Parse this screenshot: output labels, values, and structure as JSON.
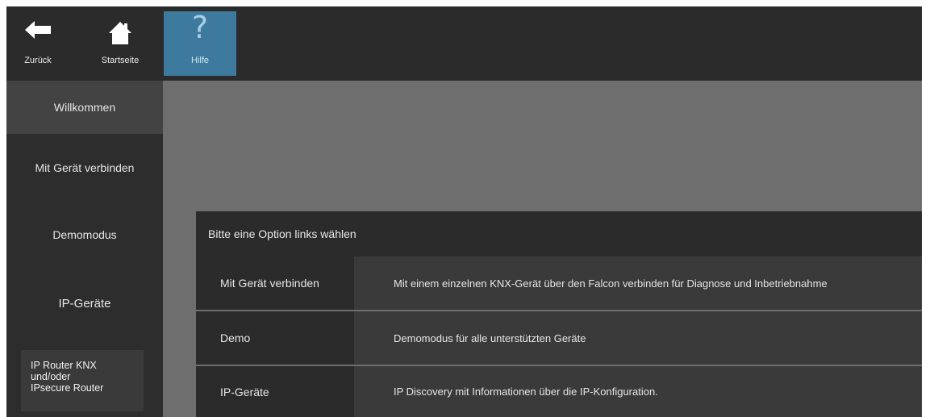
{
  "toolbar": {
    "back_label": "Zurück",
    "home_label": "Startseite",
    "help_symbol": "?",
    "help_label": "Hilfe"
  },
  "sidebar": {
    "items": [
      {
        "label": "Willkommen"
      },
      {
        "label": "Mit Gerät verbinden"
      },
      {
        "label": "Demomodus"
      },
      {
        "label": "IP-Geräte"
      }
    ],
    "router": {
      "line1": "IP Router KNX",
      "line2": "und/oder",
      "line3": "IPsecure Router"
    }
  },
  "panel": {
    "header": "Bitte eine Option links wählen",
    "options": [
      {
        "name": "Mit Gerät verbinden",
        "description": "Mit einem einzelnen KNX-Gerät über den Falcon verbinden für Diagnose und Inbetriebnahme"
      },
      {
        "name": "Demo",
        "description": "Demomodus für alle unterstützten Geräte"
      },
      {
        "name": "IP-Geräte",
        "description": "IP Discovery mit Informationen über die IP-Konfiguration."
      }
    ]
  },
  "colors": {
    "toolbar_bg": "#2b2b2b",
    "help_accent": "#3d7a9e",
    "content_bg": "#6e6e6e",
    "sidebar_active": "#434343"
  },
  "icons": {
    "back": "arrow-left-icon",
    "home": "house-icon",
    "help": "question-mark-icon"
  }
}
